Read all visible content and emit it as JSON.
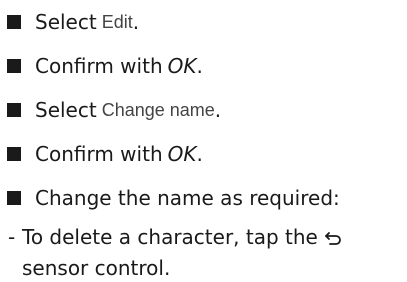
{
  "steps": [
    {
      "prefix": "Select",
      "term": "Edit",
      "suffix": "."
    },
    {
      "prefix": "Confirm with",
      "term": "OK",
      "suffix": "."
    },
    {
      "prefix": "Select",
      "term": "Change name",
      "suffix": "."
    },
    {
      "prefix": "Confirm with",
      "term": "OK",
      "suffix": "."
    },
    {
      "text": "Change the name as required:"
    }
  ],
  "substep": {
    "dash": "-",
    "line1": "To delete a character, tap the",
    "icon": "back-arrow-icon",
    "line2": "sensor control."
  },
  "colors": {
    "text": "#1a1a1a",
    "ui_term": "#444444",
    "bullet": "#1a1a1a"
  }
}
